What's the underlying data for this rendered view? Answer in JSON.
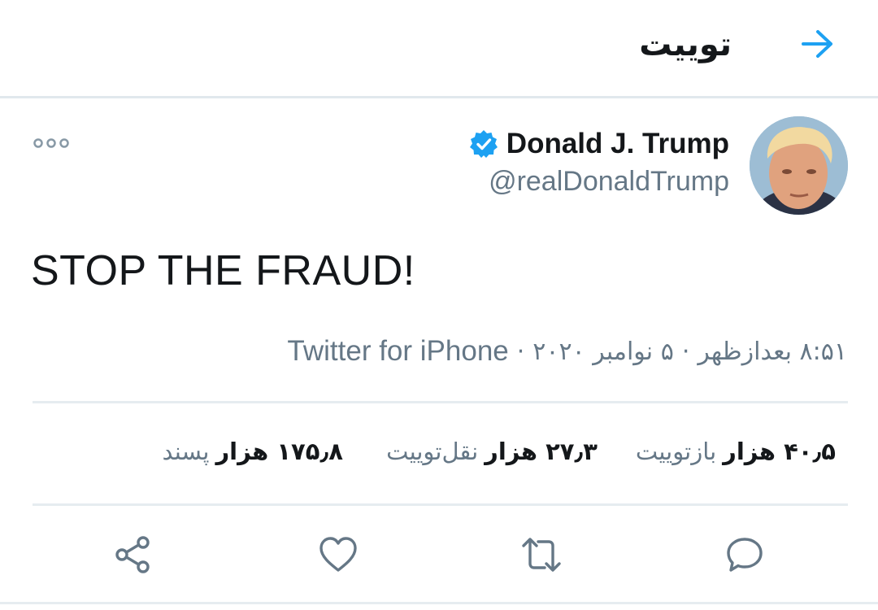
{
  "colors": {
    "accent": "#1da1f2",
    "text": "#14171a",
    "muted": "#657786",
    "divider": "#e6ecf0"
  },
  "header": {
    "title": "توییت",
    "back_icon": "arrow-right-icon"
  },
  "author": {
    "display_name": "Donald J. Trump",
    "handle": "@realDonaldTrump",
    "verified": true
  },
  "tweet": {
    "text": "STOP THE FRAUD!"
  },
  "meta": {
    "time": "۸:۵۱ بعدازظهر",
    "separator": "·",
    "date": "۵ نوامبر ۲۰۲۰",
    "source": "Twitter for iPhone"
  },
  "stats": {
    "retweets": {
      "count": "۴۰٫۵ هزار",
      "label": "بازتوییت"
    },
    "quotes": {
      "count": "۲۷٫۳ هزار",
      "label": "نقل‌توییت"
    },
    "likes": {
      "count": "۱۷۵٫۸ هزار",
      "label": "پسند"
    }
  },
  "actions": [
    "reply-icon",
    "retweet-icon",
    "like-icon",
    "share-icon"
  ]
}
